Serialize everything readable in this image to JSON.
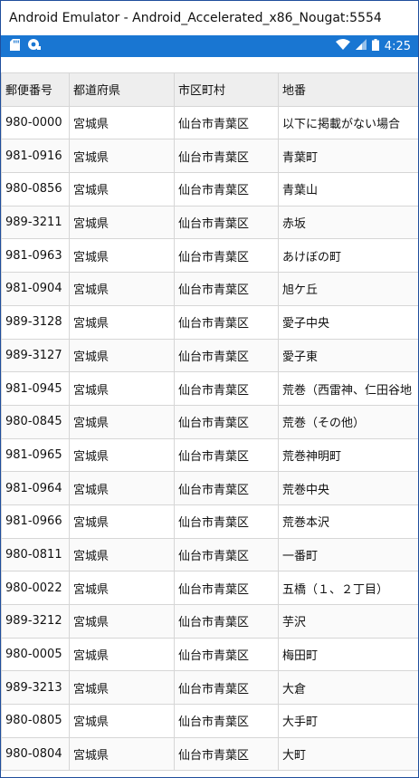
{
  "window": {
    "title": "Android Emulator - Android_Accelerated_x86_Nougat:5554"
  },
  "status_bar": {
    "time": "4:25",
    "icons": [
      "sd-card-icon",
      "app-notification-icon",
      "wifi-icon",
      "cell-signal-icon",
      "battery-icon"
    ]
  },
  "table": {
    "headers": [
      "郵便番号",
      "都道府県",
      "市区町村",
      "地番"
    ],
    "rows": [
      [
        "980-0000",
        "宮城県",
        "仙台市青葉区",
        "以下に掲載がない場合"
      ],
      [
        "981-0916",
        "宮城県",
        "仙台市青葉区",
        "青葉町"
      ],
      [
        "980-0856",
        "宮城県",
        "仙台市青葉区",
        "青葉山"
      ],
      [
        "989-3211",
        "宮城県",
        "仙台市青葉区",
        "赤坂"
      ],
      [
        "981-0963",
        "宮城県",
        "仙台市青葉区",
        "あけぼの町"
      ],
      [
        "981-0904",
        "宮城県",
        "仙台市青葉区",
        "旭ケ丘"
      ],
      [
        "989-3128",
        "宮城県",
        "仙台市青葉区",
        "愛子中央"
      ],
      [
        "989-3127",
        "宮城県",
        "仙台市青葉区",
        "愛子東"
      ],
      [
        "981-0945",
        "宮城県",
        "仙台市青葉区",
        "荒巻（西雷神、仁田谷地"
      ],
      [
        "980-0845",
        "宮城県",
        "仙台市青葉区",
        "荒巻（その他）"
      ],
      [
        "981-0965",
        "宮城県",
        "仙台市青葉区",
        "荒巻神明町"
      ],
      [
        "981-0964",
        "宮城県",
        "仙台市青葉区",
        "荒巻中央"
      ],
      [
        "981-0966",
        "宮城県",
        "仙台市青葉区",
        "荒巻本沢"
      ],
      [
        "980-0811",
        "宮城県",
        "仙台市青葉区",
        "一番町"
      ],
      [
        "980-0022",
        "宮城県",
        "仙台市青葉区",
        "五橋（１、２丁目）"
      ],
      [
        "989-3212",
        "宮城県",
        "仙台市青葉区",
        "芋沢"
      ],
      [
        "980-0005",
        "宮城県",
        "仙台市青葉区",
        "梅田町"
      ],
      [
        "989-3213",
        "宮城県",
        "仙台市青葉区",
        "大倉"
      ],
      [
        "980-0805",
        "宮城県",
        "仙台市青葉区",
        "大手町"
      ],
      [
        "980-0804",
        "宮城県",
        "仙台市青葉区",
        "大町"
      ]
    ]
  }
}
